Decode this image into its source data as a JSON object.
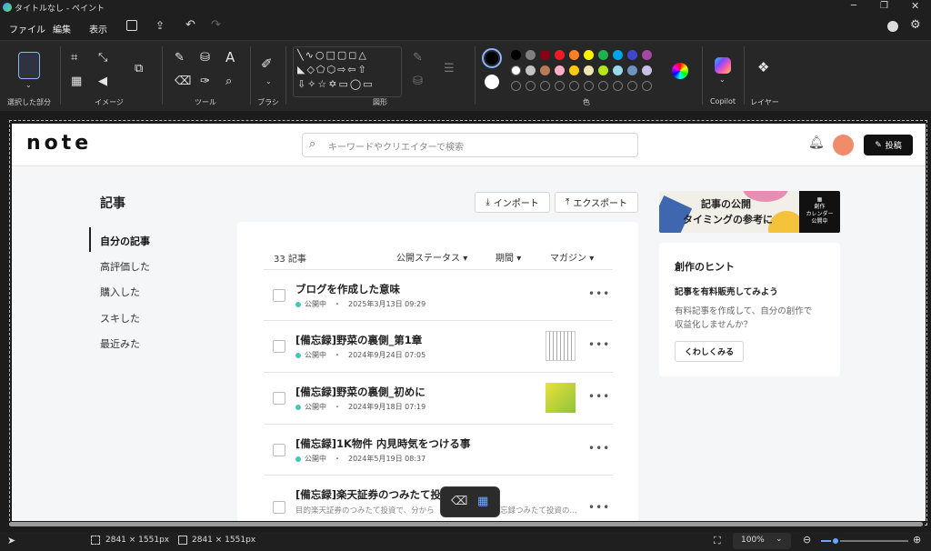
{
  "window": {
    "title": "タイトルなし - ペイント"
  },
  "menu": {
    "file": "ファイル",
    "edit": "編集",
    "view": "表示"
  },
  "ribbon": {
    "groups": {
      "selection": "選択した部分",
      "image": "イメージ",
      "tools": "ツール",
      "brush": "ブラシ",
      "shapes": "図形",
      "colors": "色",
      "copilot": "Copilot",
      "layers": "レイヤー"
    },
    "palette_row1": [
      "#000000",
      "#7f7f7f",
      "#880015",
      "#ed1c24",
      "#ff7f27",
      "#fff200",
      "#22b14c",
      "#00a2e8",
      "#3f48cc",
      "#a349a4"
    ],
    "palette_row2": [
      "#ffffff",
      "#c3c3c3",
      "#b97a57",
      "#ffaec9",
      "#ffc90e",
      "#efe4b0",
      "#b5e61d",
      "#99d9ea",
      "#7092be",
      "#c8bfe7"
    ],
    "color1": "#000000",
    "color2": "#ffffff"
  },
  "status": {
    "selection_size": "2841 × 1551px",
    "image_size": "2841 × 1551px",
    "zoom": "100%"
  },
  "note": {
    "logo": "note",
    "search_placeholder": "キーワードやクリエイターで検索",
    "post_button": "投稿",
    "section_title": "記事",
    "import_button": "インポート",
    "export_button": "エクスポート",
    "sidebar": [
      "自分の記事",
      "高評価した",
      "購入した",
      "スキした",
      "最近みた"
    ],
    "article_count": "33 記事",
    "filters": {
      "status": "公開ステータス",
      "period": "期間",
      "magazine": "マガジン"
    },
    "articles": [
      {
        "title": "ブログを作成した意味",
        "status": "公開中",
        "date": "2025年3月13日 09:29"
      },
      {
        "title": "[備忘録]野菜の裏側_第1章",
        "status": "公開中",
        "date": "2024年9月24日 07:05"
      },
      {
        "title": "[備忘録]野菜の裏側_初めに",
        "status": "公開中",
        "date": "2024年9月18日 07:19"
      },
      {
        "title": "[備忘録]1K物件 内見時気をつける事",
        "status": "公開中",
        "date": "2024年5月19日 08:37"
      },
      {
        "title": "[備忘録]楽天証券のつみたて投",
        "status": "",
        "date": "目的楽天証券のつみたて投資で、分から",
        "date_tail": "忘録つみたて投資の..."
      }
    ],
    "banner": {
      "line1": "記事の公開",
      "line2": "タイミングの参考に",
      "badge1": "創作",
      "badge2": "カレンダー",
      "badge3": "公開中"
    },
    "hint": {
      "title": "創作のヒント",
      "subtitle": "記事を有料販売してみよう",
      "body1": "有料記事を作成して、自分の創作で",
      "body2": "収益化しませんか？",
      "button": "くわしくみる"
    },
    "status_color": "#41c9b4"
  }
}
